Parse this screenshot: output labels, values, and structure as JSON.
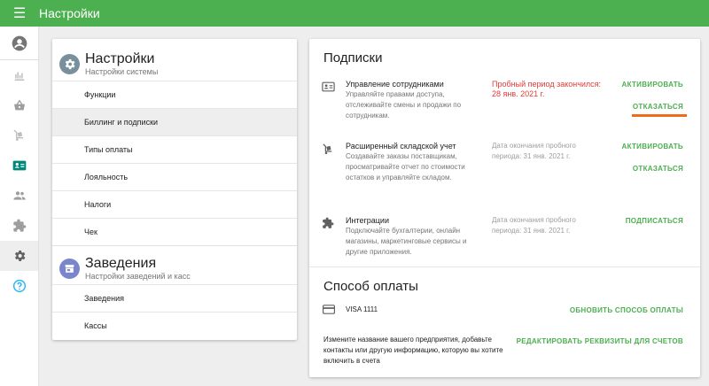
{
  "topbar": {
    "title": "Настройки"
  },
  "rail": {
    "items": [
      {
        "icon": "account-circle-icon"
      },
      {
        "icon": "bar-chart-icon"
      },
      {
        "icon": "basket-icon"
      },
      {
        "icon": "cart-icon"
      },
      {
        "icon": "id-card-icon"
      },
      {
        "icon": "people-icon"
      },
      {
        "icon": "puzzle-icon"
      },
      {
        "icon": "gear-icon",
        "active": true
      },
      {
        "icon": "help-icon"
      }
    ]
  },
  "settings": {
    "title": "Настройки",
    "subtitle": "Настройки системы",
    "items": [
      {
        "label": "Функции"
      },
      {
        "label": "Биллинг и подписки",
        "active": true
      },
      {
        "label": "Типы оплаты"
      },
      {
        "label": "Лояльность"
      },
      {
        "label": "Налоги"
      },
      {
        "label": "Чек"
      }
    ]
  },
  "venues": {
    "title": "Заведения",
    "subtitle": "Настройки заведений и касс",
    "items": [
      {
        "label": "Заведения"
      },
      {
        "label": "Кассы"
      }
    ]
  },
  "subscriptions": {
    "title": "Подписки",
    "rows": [
      {
        "name": "Управление сотрудниками",
        "desc": "Управляйте правами доступа, отслеживайте смены и продажи по сотрудникам.",
        "status": "Пробный период закончился: 28 янв. 2021 г.",
        "action1": "Активировать",
        "action2": "Отказаться"
      },
      {
        "name": "Расширенный складской учет",
        "desc": "Создавайте заказы поставщикам, просматривайте отчет по стоимости остатков и управляйте складом.",
        "status": "Дата окончания пробного периода: 31 янв. 2021 г.",
        "action1": "Активировать",
        "action2": "Отказаться"
      },
      {
        "name": "Интеграции",
        "desc": "Подключайте бухгалтерии, онлайн магазины, маркетинговые сервисы и другие приложения.",
        "status": "Дата окончания пробного периода: 31 янв. 2021 г.",
        "action1": "Подписаться"
      }
    ]
  },
  "payment": {
    "title": "Способ оплаты",
    "card": "VISA 1111",
    "update_label": "Обновить способ оплаты",
    "info": "Измените название вашего предприятия, добавьте контакты или другую информацию, которую вы хотите включить в счета",
    "edit_label": "Редактировать реквизиты для счетов"
  },
  "colors": {
    "primary": "#4caf50",
    "accent": "#ef6c1a",
    "expired": "#e53935"
  }
}
